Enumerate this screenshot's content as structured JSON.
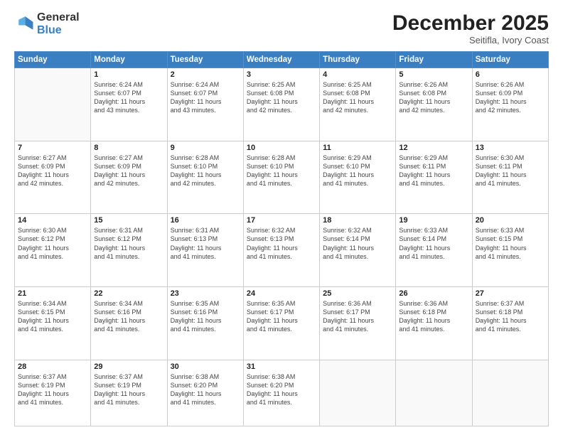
{
  "header": {
    "logo_general": "General",
    "logo_blue": "Blue",
    "month_title": "December 2025",
    "location": "Seitifla, Ivory Coast"
  },
  "days_of_week": [
    "Sunday",
    "Monday",
    "Tuesday",
    "Wednesday",
    "Thursday",
    "Friday",
    "Saturday"
  ],
  "weeks": [
    [
      {
        "day": "",
        "info": ""
      },
      {
        "day": "1",
        "info": "Sunrise: 6:24 AM\nSunset: 6:07 PM\nDaylight: 11 hours\nand 43 minutes."
      },
      {
        "day": "2",
        "info": "Sunrise: 6:24 AM\nSunset: 6:07 PM\nDaylight: 11 hours\nand 43 minutes."
      },
      {
        "day": "3",
        "info": "Sunrise: 6:25 AM\nSunset: 6:08 PM\nDaylight: 11 hours\nand 42 minutes."
      },
      {
        "day": "4",
        "info": "Sunrise: 6:25 AM\nSunset: 6:08 PM\nDaylight: 11 hours\nand 42 minutes."
      },
      {
        "day": "5",
        "info": "Sunrise: 6:26 AM\nSunset: 6:08 PM\nDaylight: 11 hours\nand 42 minutes."
      },
      {
        "day": "6",
        "info": "Sunrise: 6:26 AM\nSunset: 6:09 PM\nDaylight: 11 hours\nand 42 minutes."
      }
    ],
    [
      {
        "day": "7",
        "info": "Sunrise: 6:27 AM\nSunset: 6:09 PM\nDaylight: 11 hours\nand 42 minutes."
      },
      {
        "day": "8",
        "info": "Sunrise: 6:27 AM\nSunset: 6:09 PM\nDaylight: 11 hours\nand 42 minutes."
      },
      {
        "day": "9",
        "info": "Sunrise: 6:28 AM\nSunset: 6:10 PM\nDaylight: 11 hours\nand 42 minutes."
      },
      {
        "day": "10",
        "info": "Sunrise: 6:28 AM\nSunset: 6:10 PM\nDaylight: 11 hours\nand 41 minutes."
      },
      {
        "day": "11",
        "info": "Sunrise: 6:29 AM\nSunset: 6:10 PM\nDaylight: 11 hours\nand 41 minutes."
      },
      {
        "day": "12",
        "info": "Sunrise: 6:29 AM\nSunset: 6:11 PM\nDaylight: 11 hours\nand 41 minutes."
      },
      {
        "day": "13",
        "info": "Sunrise: 6:30 AM\nSunset: 6:11 PM\nDaylight: 11 hours\nand 41 minutes."
      }
    ],
    [
      {
        "day": "14",
        "info": "Sunrise: 6:30 AM\nSunset: 6:12 PM\nDaylight: 11 hours\nand 41 minutes."
      },
      {
        "day": "15",
        "info": "Sunrise: 6:31 AM\nSunset: 6:12 PM\nDaylight: 11 hours\nand 41 minutes."
      },
      {
        "day": "16",
        "info": "Sunrise: 6:31 AM\nSunset: 6:13 PM\nDaylight: 11 hours\nand 41 minutes."
      },
      {
        "day": "17",
        "info": "Sunrise: 6:32 AM\nSunset: 6:13 PM\nDaylight: 11 hours\nand 41 minutes."
      },
      {
        "day": "18",
        "info": "Sunrise: 6:32 AM\nSunset: 6:14 PM\nDaylight: 11 hours\nand 41 minutes."
      },
      {
        "day": "19",
        "info": "Sunrise: 6:33 AM\nSunset: 6:14 PM\nDaylight: 11 hours\nand 41 minutes."
      },
      {
        "day": "20",
        "info": "Sunrise: 6:33 AM\nSunset: 6:15 PM\nDaylight: 11 hours\nand 41 minutes."
      }
    ],
    [
      {
        "day": "21",
        "info": "Sunrise: 6:34 AM\nSunset: 6:15 PM\nDaylight: 11 hours\nand 41 minutes."
      },
      {
        "day": "22",
        "info": "Sunrise: 6:34 AM\nSunset: 6:16 PM\nDaylight: 11 hours\nand 41 minutes."
      },
      {
        "day": "23",
        "info": "Sunrise: 6:35 AM\nSunset: 6:16 PM\nDaylight: 11 hours\nand 41 minutes."
      },
      {
        "day": "24",
        "info": "Sunrise: 6:35 AM\nSunset: 6:17 PM\nDaylight: 11 hours\nand 41 minutes."
      },
      {
        "day": "25",
        "info": "Sunrise: 6:36 AM\nSunset: 6:17 PM\nDaylight: 11 hours\nand 41 minutes."
      },
      {
        "day": "26",
        "info": "Sunrise: 6:36 AM\nSunset: 6:18 PM\nDaylight: 11 hours\nand 41 minutes."
      },
      {
        "day": "27",
        "info": "Sunrise: 6:37 AM\nSunset: 6:18 PM\nDaylight: 11 hours\nand 41 minutes."
      }
    ],
    [
      {
        "day": "28",
        "info": "Sunrise: 6:37 AM\nSunset: 6:19 PM\nDaylight: 11 hours\nand 41 minutes."
      },
      {
        "day": "29",
        "info": "Sunrise: 6:37 AM\nSunset: 6:19 PM\nDaylight: 11 hours\nand 41 minutes."
      },
      {
        "day": "30",
        "info": "Sunrise: 6:38 AM\nSunset: 6:20 PM\nDaylight: 11 hours\nand 41 minutes."
      },
      {
        "day": "31",
        "info": "Sunrise: 6:38 AM\nSunset: 6:20 PM\nDaylight: 11 hours\nand 41 minutes."
      },
      {
        "day": "",
        "info": ""
      },
      {
        "day": "",
        "info": ""
      },
      {
        "day": "",
        "info": ""
      }
    ]
  ]
}
